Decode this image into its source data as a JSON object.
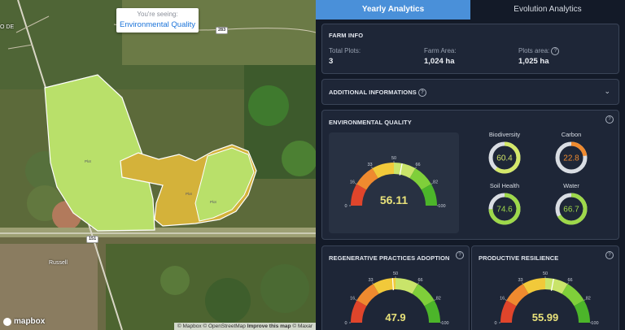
{
  "map": {
    "seeing_label": "You're seeing:",
    "seeing_value": "Environmental Quality",
    "road_labels": [
      "283",
      "151"
    ],
    "town_name": "Russell",
    "corner_label": "O DE",
    "logo_text": "mapbox",
    "attribution": {
      "mapbox": "© Mapbox",
      "osm": "© OpenStreetMap",
      "improve": "Improve this map",
      "maxar": "© Maxar"
    },
    "plot_labels": [
      "Plot",
      "Plot",
      "Plot"
    ]
  },
  "tabs": [
    {
      "label": "Yearly Analytics",
      "active": true
    },
    {
      "label": "Evolution Analytics",
      "active": false
    }
  ],
  "farm_info": {
    "title": "FARM INFO",
    "total_plots_label": "Total Plots:",
    "total_plots_value": "3",
    "farm_area_label": "Farm Area:",
    "farm_area_value": "1,024 ha",
    "plots_area_label": "Plots area:",
    "plots_area_value": "1,025 ha"
  },
  "additional": {
    "title": "ADDITIONAL INFORMATIONS"
  },
  "env_quality": {
    "title": "ENVIRONMENTAL QUALITY",
    "gauge": {
      "value": "56.11",
      "numeric": 56.11,
      "ticks": [
        "0",
        "16",
        "33",
        "50",
        "66",
        "82",
        "100"
      ]
    },
    "metrics": [
      {
        "label": "Biodiversity",
        "value": "60.4",
        "numeric": 60.4,
        "color": "#d4e86a"
      },
      {
        "label": "Carbon",
        "value": "22.8",
        "numeric": 22.8,
        "color": "#ef8a2f"
      },
      {
        "label": "Soil Health",
        "value": "74.6",
        "numeric": 74.6,
        "color": "#9ed84a"
      },
      {
        "label": "Water",
        "value": "66.7",
        "numeric": 66.7,
        "color": "#9ed84a"
      }
    ]
  },
  "regen": {
    "title": "REGENERATIVE PRACTICES ADOPTION",
    "gauge": {
      "value": "47.9",
      "numeric": 47.9,
      "ticks": [
        "0",
        "16",
        "33",
        "50",
        "66",
        "82",
        "100"
      ]
    }
  },
  "resilience": {
    "title": "PRODUCTIVE RESILIENCE",
    "gauge": {
      "value": "55.99",
      "numeric": 55.99,
      "ticks": [
        "0",
        "16",
        "33",
        "50",
        "66",
        "82",
        "100"
      ]
    }
  },
  "colors": {
    "accent": "#4a90d9",
    "red": "#e0452b",
    "orange": "#ef8a2f",
    "yellow": "#f1c93a",
    "lightgreen": "#c9e46a",
    "green": "#7fcf3a",
    "darkgreen": "#4cb52a"
  }
}
